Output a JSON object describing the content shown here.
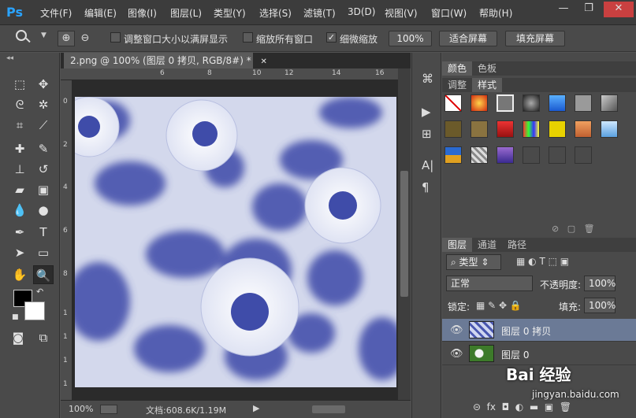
{
  "app": {
    "logo": "Ps"
  },
  "menu": [
    "文件(F)",
    "编辑(E)",
    "图像(I)",
    "图层(L)",
    "类型(Y)",
    "选择(S)",
    "滤镜(T)",
    "3D(D)",
    "视图(V)",
    "窗口(W)",
    "帮助(H)"
  ],
  "window_controls": {
    "minimize": "—",
    "restore": "❐",
    "close": "✕"
  },
  "options": {
    "resize_windows": "调整窗口大小以满屏显示",
    "zoom_all": "缩放所有窗口",
    "scrubby_zoom": "细微缩放",
    "scrubby_checked": "✓",
    "zoom_100": "100%",
    "fit_screen": "适合屏幕",
    "fill_screen": "填充屏幕"
  },
  "document": {
    "tab_title": "2.png @ 100% (图层 0 拷贝, RGB/8#) *",
    "tab_close": "✕",
    "ruler_top": [
      "6",
      "8",
      "10",
      "12",
      "14",
      "16"
    ],
    "ruler_left": [
      "0",
      "2",
      "4",
      "6",
      "8",
      "1",
      "1",
      "1",
      "1"
    ],
    "status_zoom": "100%",
    "status_doc": "文档:608.6K/1.19M"
  },
  "panels": {
    "color_tab": "颜色",
    "swatches_tab": "色板",
    "adjust_tab": "调整",
    "styles_tab": "样式",
    "layers_tab": "图层",
    "channels_tab": "通道",
    "paths_tab": "路径",
    "filter_kind": "类型",
    "blend_mode": "正常",
    "opacity_label": "不透明度:",
    "opacity_value": "100%",
    "lock_label": "锁定:",
    "fill_label": "填充:",
    "fill_value": "100%"
  },
  "layers": [
    {
      "name": "图层 0 拷贝",
      "selected": true
    },
    {
      "name": "图层 0",
      "selected": false
    }
  ],
  "watermark": {
    "brand": "Bai 经验",
    "url": "jingyan.baidu.com"
  }
}
